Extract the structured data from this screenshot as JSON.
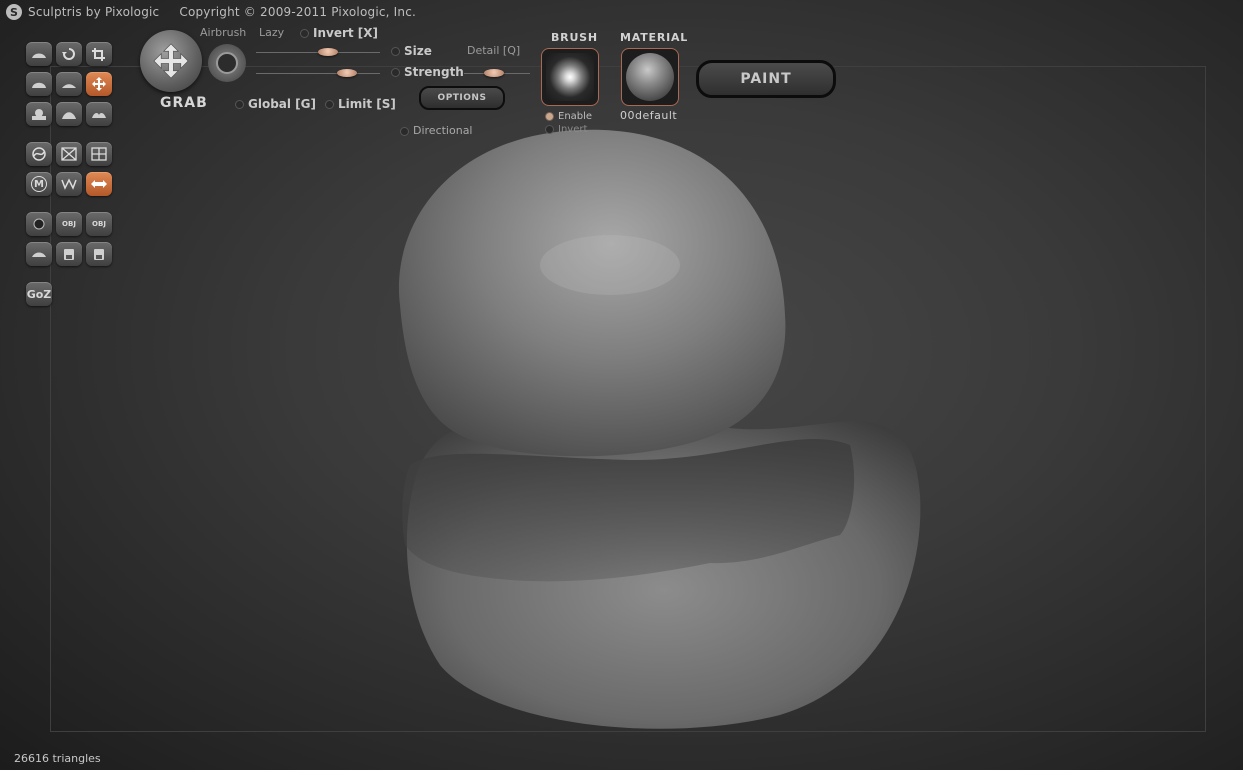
{
  "app": {
    "title": "Sculptris by Pixologic",
    "copyright": "Copyright © 2009-2011 Pixologic, Inc."
  },
  "toolbar": {
    "rows": [
      [
        "sculpt-draw",
        "rotate",
        "crop"
      ],
      [
        "inflate",
        "flatten",
        "grab"
      ],
      [
        "pinch",
        "smooth",
        "crease"
      ],
      [
        "symmetry",
        "wireframe",
        "grid"
      ],
      [
        "material",
        "subdivide",
        "swap"
      ],
      [
        "sphere",
        "import-obj",
        "export-obj"
      ],
      [
        "plane",
        "open",
        "save"
      ]
    ],
    "active": [
      "grab",
      "swap"
    ],
    "goz_label": "GoZ",
    "obj_label": "OBJ",
    "m_label": "M"
  },
  "brush_panel": {
    "tool_name": "GRAB",
    "airbrush_label": "Airbrush",
    "lazy_label": "Lazy",
    "invert_label": "Invert [X]",
    "size_label": "Size",
    "strength_label": "Strength",
    "detail_label": "Detail [Q]",
    "options_label": "OPTIONS",
    "global_label": "Global [G]",
    "limit_label": "Limit [S]",
    "directional_label": "Directional",
    "size_value": 0.55,
    "strength_value": 0.72,
    "detail_value": 0.4
  },
  "brush_section": {
    "title": "BRUSH",
    "enable_label": "Enable",
    "invert_label": "Invert"
  },
  "material_section": {
    "title": "MATERIAL",
    "name": "00default"
  },
  "paint_button": "PAINT",
  "status": {
    "triangles": "26616 triangles"
  },
  "colors": {
    "accent": "#c8683a",
    "slider_knob": "#d8a48a",
    "background": "#2e2e2e"
  }
}
